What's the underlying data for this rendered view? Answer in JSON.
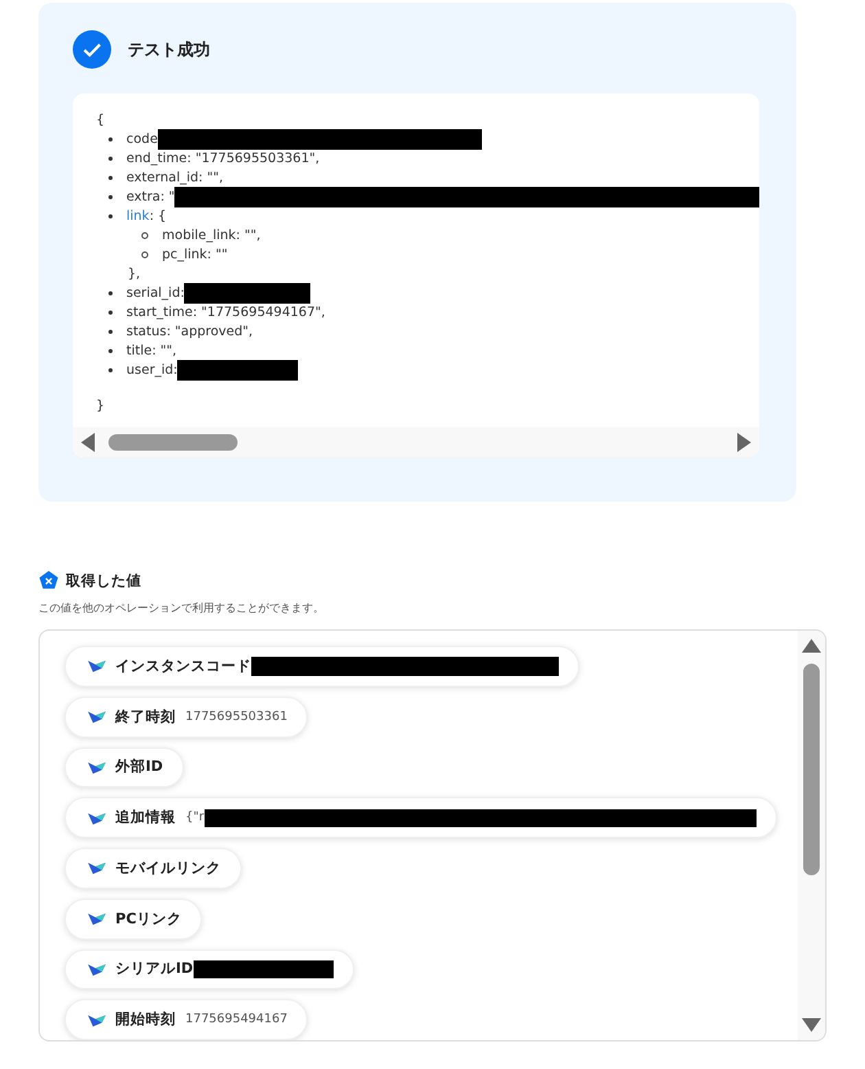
{
  "result": {
    "title": "テスト成功",
    "success": true
  },
  "code_lines": [
    {
      "kind": "brace",
      "text": "{"
    },
    {
      "kind": "item",
      "text": "code",
      "redacted": true
    },
    {
      "kind": "item",
      "text": "end_time: \"1775695503361\","
    },
    {
      "kind": "item",
      "text": "external_id: \"\","
    },
    {
      "kind": "item",
      "text": "extra: \"",
      "redacted": true
    },
    {
      "kind": "object",
      "key": "link",
      "text": ": {"
    },
    {
      "kind": "subitem",
      "text": "mobile_link: \"\","
    },
    {
      "kind": "subitem",
      "text": "pc_link: \"\""
    },
    {
      "kind": "close",
      "text": "},"
    },
    {
      "kind": "item",
      "text": "serial_id: ",
      "redacted": true
    },
    {
      "kind": "item",
      "text": "start_time: \"1775695494167\","
    },
    {
      "kind": "item",
      "text": "status: \"approved\","
    },
    {
      "kind": "item",
      "text": "title: \"\","
    },
    {
      "kind": "item",
      "text": "user_id:",
      "redacted": true
    },
    {
      "kind": "brace",
      "text": "}"
    }
  ],
  "values_section": {
    "title": "取得した値",
    "description": "この値を他のオペレーションで利用することができます。"
  },
  "values": [
    {
      "label": "インスタンスコード",
      "redacted": true
    },
    {
      "label": "終了時刻",
      "value": "1775695503361"
    },
    {
      "label": "外部ID"
    },
    {
      "label": "追加情報",
      "value": "{\"r",
      "redacted": true
    },
    {
      "label": "モバイルリンク"
    },
    {
      "label": "PCリンク"
    },
    {
      "label": "シリアルID",
      "redacted": true
    },
    {
      "label": "開始時刻",
      "value": "1775695494167"
    }
  ]
}
